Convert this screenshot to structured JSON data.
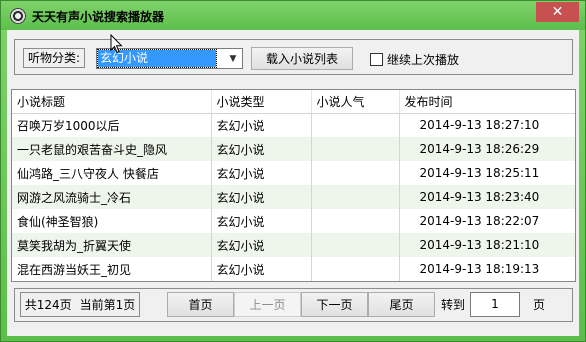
{
  "window": {
    "title": "天天有声小说搜索播放器",
    "close_label": "✕"
  },
  "filter": {
    "category_label": "听物分类:",
    "category_value": "玄幻小说",
    "load_button": "载入小说列表",
    "continue_label": "继续上次播放"
  },
  "table": {
    "headers": [
      "小说标题",
      "小说类型",
      "小说人气",
      "发布时间"
    ],
    "rows": [
      [
        "召唤万岁1000以后",
        "玄幻小说",
        "",
        "2014-9-13 18:27:10"
      ],
      [
        "一只老鼠的艰苦奋斗史_隐风",
        "玄幻小说",
        "",
        "2014-9-13 18:26:29"
      ],
      [
        "仙鸿路_三八守夜人 快餐店",
        "玄幻小说",
        "",
        "2014-9-13 18:25:11"
      ],
      [
        "网游之风流骑士_冷石",
        "玄幻小说",
        "",
        "2014-9-13 18:23:40"
      ],
      [
        "食仙(神圣智狼)",
        "玄幻小说",
        "",
        "2014-9-13 18:22:07"
      ],
      [
        "莫笑我胡为_折翼天使",
        "玄幻小说",
        "",
        "2014-9-13 18:21:10"
      ],
      [
        "混在西游当妖王_初见",
        "玄幻小说",
        "",
        "2014-9-13 18:19:13"
      ]
    ]
  },
  "pager": {
    "total": "共124页",
    "current": "当前第1页",
    "first": "首页",
    "prev": "上一页",
    "next": "下一页",
    "last": "尾页",
    "goto_label": "转到",
    "page_value": "1",
    "page_unit": "页"
  }
}
